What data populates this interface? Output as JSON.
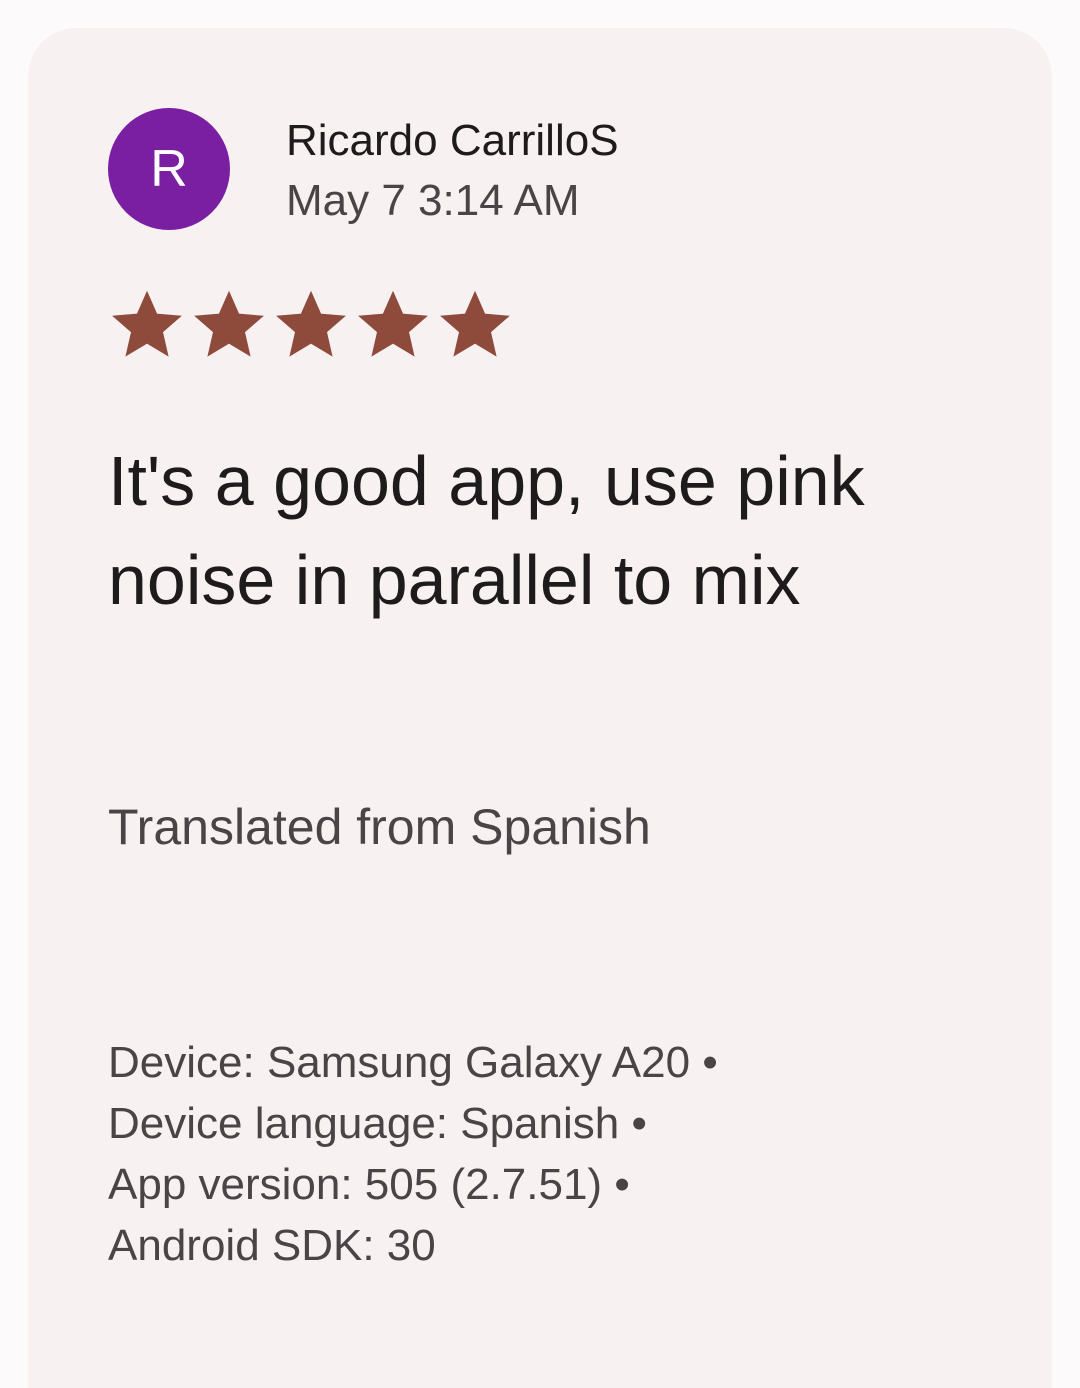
{
  "review": {
    "avatar_initial": "R",
    "avatar_color": "#7b1fa2",
    "author_name": "Ricardo CarrilloS",
    "date": "May 7 3:14 AM",
    "rating": 5,
    "rating_max": 5,
    "star_color": "#8e4a3a",
    "text": "It's a good app, use pink noise in parallel to mix",
    "translation_note": "Translated from Spanish",
    "separator": "•",
    "meta": [
      "Device: Samsung Galaxy A20",
      "Device language: Spanish",
      "App version: 505 (2.7.51)",
      "Android SDK: 30"
    ]
  }
}
